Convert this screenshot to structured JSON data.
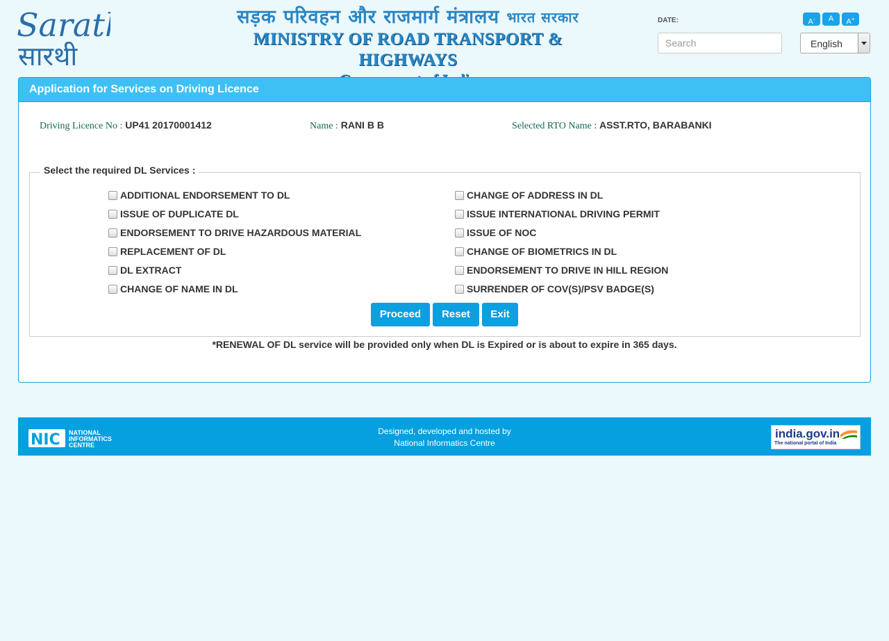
{
  "header": {
    "logo_text_top": "Sarathi",
    "logo_text_bottom": "सारथी",
    "ministry_hindi": "सड़क परिवहन और राजमार्ग मंत्रालय",
    "ministry_hindi_small": "भारत सरकार",
    "ministry_english": "MINISTRY OF ROAD TRANSPORT & HIGHWAYS",
    "government": "Government of India",
    "date_label": "DATE:",
    "search_placeholder": "Search",
    "font_buttons": [
      "A-",
      "A",
      "A+"
    ],
    "language": "English"
  },
  "panel": {
    "title": "Application for Services on Driving Licence",
    "dl_label": "Driving Licence No :",
    "dl_value": "UP41 20170001412",
    "name_label": "Name :",
    "name_value": "RANI B B",
    "rto_label": "Selected RTO Name :",
    "rto_value": "ASST.RTO, BARABANKI",
    "legend": "Select the required DL Services :",
    "services_left": [
      "ADDITIONAL ENDORSEMENT TO DL",
      "ISSUE OF DUPLICATE DL",
      "ENDORSEMENT TO DRIVE HAZARDOUS MATERIAL",
      "REPLACEMENT OF DL",
      "DL EXTRACT",
      "CHANGE OF NAME IN DL"
    ],
    "services_right": [
      "CHANGE OF ADDRESS IN DL",
      "ISSUE INTERNATIONAL DRIVING PERMIT",
      "ISSUE OF NOC",
      "CHANGE OF BIOMETRICS IN DL",
      "ENDORSEMENT TO DRIVE IN HILL REGION",
      "SURRENDER OF COV(S)/PSV BADGE(S)"
    ],
    "buttons": {
      "proceed": "Proceed",
      "reset": "Reset",
      "exit": "Exit"
    },
    "note": "*RENEWAL OF DL service will be provided only when DL is Expired or is about to expire in 365 days."
  },
  "footer": {
    "nic_line1": "NATIONAL",
    "nic_line2": "INFORMATICS",
    "nic_line3": "CENTRE",
    "credit_line1": "Designed, developed and hosted by",
    "credit_line2": "National Informatics Centre",
    "portal_name": "india.gov.in",
    "portal_tagline": "The national portal of India"
  },
  "colors": {
    "page_bg": "#ebf8fc",
    "panel_head": "#3ec0f5",
    "button": "#0d9fdf",
    "footer": "#069fdf",
    "label_green": "#16675a"
  }
}
